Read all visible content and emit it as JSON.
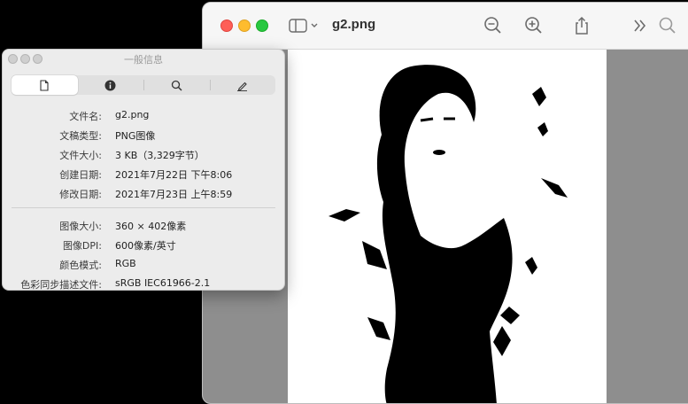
{
  "preview": {
    "title": "g2.png"
  },
  "info_panel": {
    "title": "一般信息",
    "tabs": [
      {
        "icon": "document-icon"
      },
      {
        "icon": "info-icon"
      },
      {
        "icon": "search-icon"
      },
      {
        "icon": "pencil-icon"
      }
    ],
    "file_rows": [
      {
        "label": "文件名:",
        "value": "g2.png"
      },
      {
        "label": "文稿类型:",
        "value": "PNG图像"
      },
      {
        "label": "文件大小:",
        "value": "3 KB（3,329字节）"
      },
      {
        "label": "创建日期:",
        "value": "2021年7月22日 下午8:06"
      },
      {
        "label": "修改日期:",
        "value": "2021年7月23日 上午8:59"
      }
    ],
    "image_rows": [
      {
        "label": "图像大小:",
        "value": "360 × 402像素"
      },
      {
        "label": "图像DPI:",
        "value": "600像素/英寸"
      },
      {
        "label": "颜色模式:",
        "value": "RGB"
      },
      {
        "label": "色彩同步描述文件:",
        "value": "sRGB IEC61966-2.1"
      }
    ]
  },
  "colors": {
    "close": "#fe5f57",
    "minimize": "#febc2e",
    "zoom": "#28c840"
  }
}
